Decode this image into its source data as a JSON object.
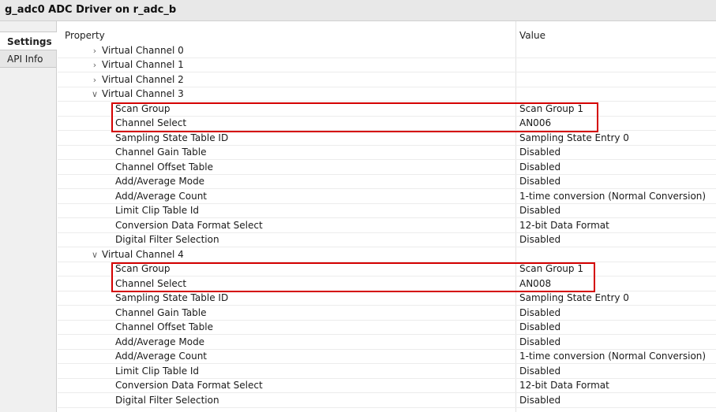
{
  "window": {
    "title": "g_adc0 ADC Driver on r_adc_b"
  },
  "sidebar": {
    "tabs": [
      "Settings",
      "API Info"
    ]
  },
  "table": {
    "headers": {
      "property": "Property",
      "value": "Value"
    },
    "channels": [
      {
        "label": "Virtual Channel 0",
        "expanded": false
      },
      {
        "label": "Virtual Channel 1",
        "expanded": false
      },
      {
        "label": "Virtual Channel 2",
        "expanded": false
      },
      {
        "label": "Virtual Channel 3",
        "expanded": true,
        "props": [
          {
            "name": "Scan Group",
            "value": "Scan Group 1"
          },
          {
            "name": "Channel Select",
            "value": "AN006"
          },
          {
            "name": "Sampling State Table ID",
            "value": "Sampling State Entry 0"
          },
          {
            "name": "Channel Gain Table",
            "value": "Disabled"
          },
          {
            "name": "Channel Offset Table",
            "value": "Disabled"
          },
          {
            "name": "Add/Average Mode",
            "value": "Disabled"
          },
          {
            "name": "Add/Average Count",
            "value": "1-time conversion (Normal Conversion)"
          },
          {
            "name": "Limit Clip Table Id",
            "value": "Disabled"
          },
          {
            "name": "Conversion Data Format Select",
            "value": "12-bit Data Format"
          },
          {
            "name": "Digital Filter Selection",
            "value": "Disabled"
          }
        ]
      },
      {
        "label": "Virtual Channel 4",
        "expanded": true,
        "props": [
          {
            "name": "Scan Group",
            "value": "Scan Group 1"
          },
          {
            "name": "Channel Select",
            "value": "AN008"
          },
          {
            "name": "Sampling State Table ID",
            "value": "Sampling State Entry 0"
          },
          {
            "name": "Channel Gain Table",
            "value": "Disabled"
          },
          {
            "name": "Channel Offset Table",
            "value": "Disabled"
          },
          {
            "name": "Add/Average Mode",
            "value": "Disabled"
          },
          {
            "name": "Add/Average Count",
            "value": "1-time conversion (Normal Conversion)"
          },
          {
            "name": "Limit Clip Table Id",
            "value": "Disabled"
          },
          {
            "name": "Conversion Data Format Select",
            "value": "12-bit Data Format"
          },
          {
            "name": "Digital Filter Selection",
            "value": "Disabled"
          }
        ]
      }
    ]
  },
  "icons": {
    "collapsed": "chevron-right-icon",
    "expanded": "chevron-down-icon"
  },
  "colors": {
    "highlight": "#d40000",
    "title_bar": "#e8e8e8",
    "sidebar": "#f0f0f0"
  }
}
